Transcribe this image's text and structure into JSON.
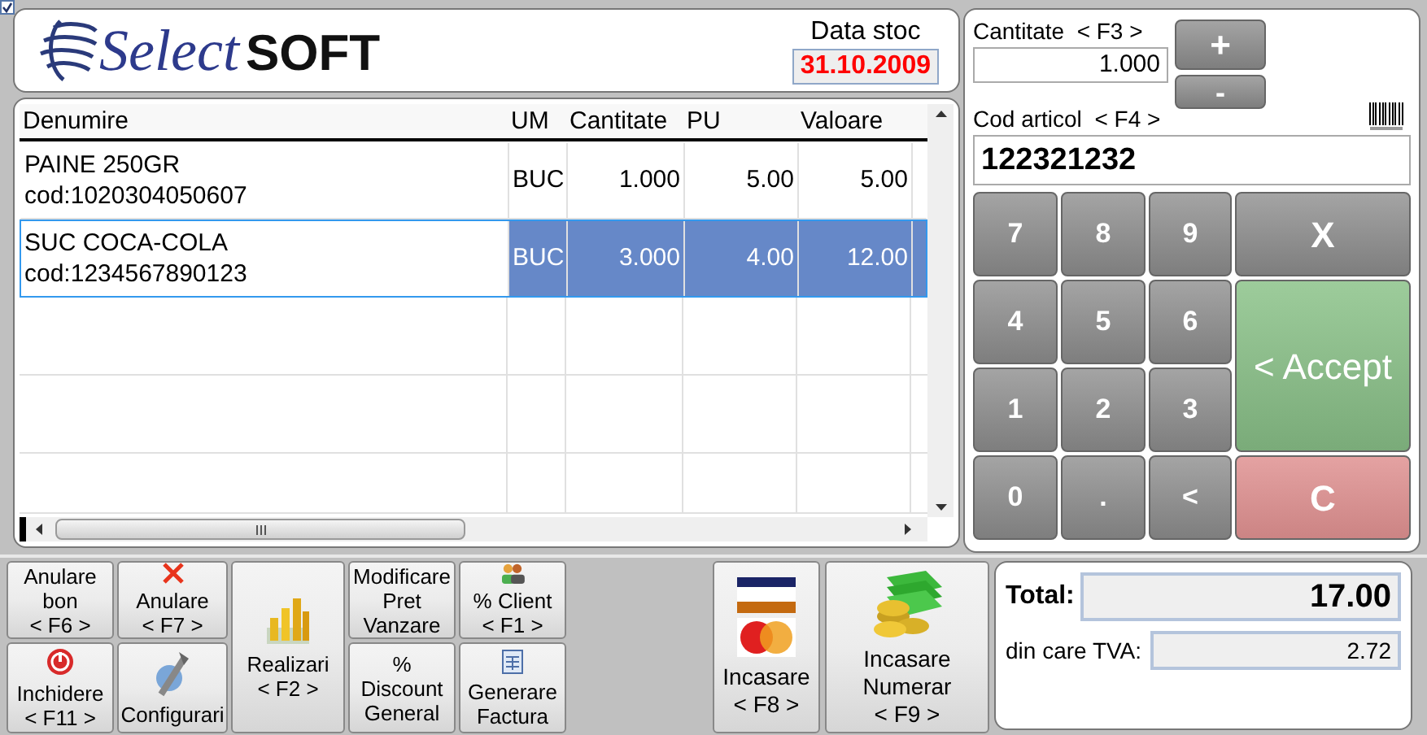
{
  "window": {
    "checked": true
  },
  "logo": {
    "select": "Select",
    "soft": "SOFT"
  },
  "stock_date": {
    "label": "Data stoc",
    "value": "31.10.2009"
  },
  "table": {
    "columns": [
      "Denumire",
      "UM",
      "Cantitate",
      "PU",
      "Valoare"
    ],
    "rows": [
      {
        "name": "PAINE 250GR",
        "code": "cod:1020304050607",
        "um": "BUC",
        "qty": "1.000",
        "pu": "5.00",
        "value": "5.00",
        "selected": false
      },
      {
        "name": "SUC COCA-COLA",
        "code": "cod:1234567890123",
        "um": "BUC",
        "qty": "3.000",
        "pu": "4.00",
        "value": "12.00",
        "selected": true
      }
    ]
  },
  "quantity": {
    "label": "Cantitate  < F3 >",
    "value": "1.000",
    "plus": "+",
    "minus": "-"
  },
  "article_code": {
    "label": "Cod articol  < F4 >",
    "value": "122321232"
  },
  "keypad": [
    {
      "label": "7",
      "kind": "digit"
    },
    {
      "label": "8",
      "kind": "digit"
    },
    {
      "label": "9",
      "kind": "digit"
    },
    {
      "label": "X",
      "kind": "cancel"
    },
    {
      "label": "4",
      "kind": "digit"
    },
    {
      "label": "5",
      "kind": "digit"
    },
    {
      "label": "6",
      "kind": "digit"
    },
    {
      "label": "< Accept",
      "kind": "accept"
    },
    {
      "label": "1",
      "kind": "digit"
    },
    {
      "label": "2",
      "kind": "digit"
    },
    {
      "label": "3",
      "kind": "digit"
    },
    {
      "label": "0",
      "kind": "digit"
    },
    {
      "label": ".",
      "kind": "digit"
    },
    {
      "label": "<",
      "kind": "digit"
    },
    {
      "label": "C",
      "kind": "clear"
    }
  ],
  "actions": [
    {
      "lines": [
        "Anulare",
        "bon",
        "< F6 >"
      ]
    },
    {
      "lines": [
        "Anulare",
        "< F7 >"
      ]
    },
    {
      "lines": [
        "Realizari",
        "< F2 >"
      ]
    },
    {
      "lines": [
        "Modificare",
        "Pret",
        "Vanzare"
      ]
    },
    {
      "lines": [
        "% Client",
        "< F1 >"
      ]
    },
    {
      "lines": [
        "Inchidere",
        "< F11 >"
      ]
    },
    {
      "lines": [
        "Configurari"
      ]
    },
    {
      "lines": [
        "%",
        "Discount",
        "General"
      ]
    },
    {
      "lines": [
        "Generare",
        "Factura"
      ]
    }
  ],
  "payments": [
    {
      "lines": [
        "Incasare",
        "< F8 >"
      ]
    },
    {
      "lines": [
        "Incasare",
        "Numerar",
        "< F9 >"
      ]
    }
  ],
  "totals": {
    "total_label": "Total:",
    "total": "17.00",
    "vat_label": "din care TVA:",
    "vat": "2.72"
  }
}
